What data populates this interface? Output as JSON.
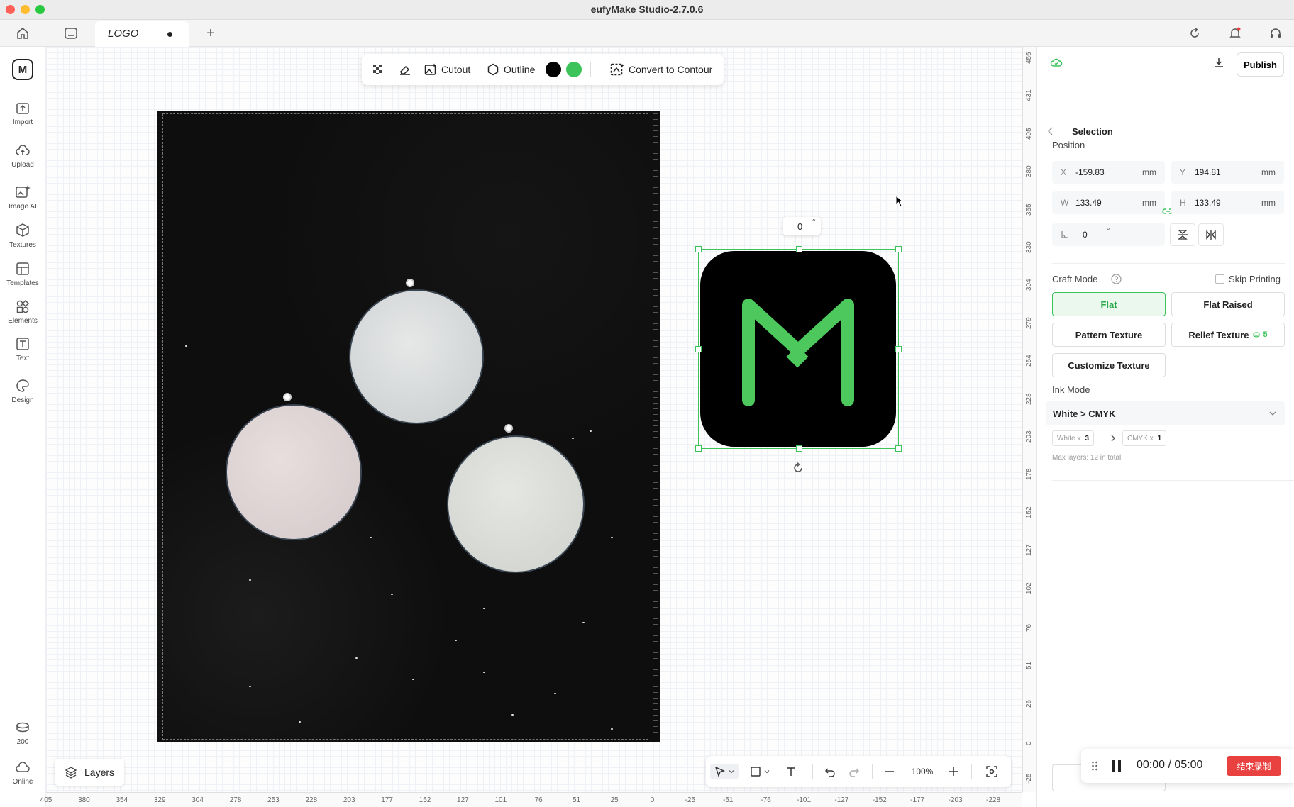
{
  "window": {
    "title": "eufyMake Studio-2.7.0.6"
  },
  "tabs": {
    "active_tab": "LOGO",
    "add": "+"
  },
  "sidebar": {
    "items": [
      {
        "label": "Import"
      },
      {
        "label": "Upload"
      },
      {
        "label": "Image AI"
      },
      {
        "label": "Textures"
      },
      {
        "label": "Templates"
      },
      {
        "label": "Elements"
      },
      {
        "label": "Text"
      },
      {
        "label": "Design"
      }
    ],
    "credits": "200",
    "online": "Online"
  },
  "float_toolbar": {
    "cutout": "Cutout",
    "outline": "Outline",
    "convert": "Convert to Contour",
    "colors": [
      "#000000",
      "#3cc35a"
    ]
  },
  "canvas": {
    "rotation_value": "0",
    "rotation_unit": "°",
    "layers_button": "Layers",
    "zoom": "100%"
  },
  "ruler_bottom": [
    "405",
    "380",
    "354",
    "329",
    "304",
    "278",
    "253",
    "228",
    "203",
    "177",
    "152",
    "127",
    "101",
    "76",
    "51",
    "25",
    "0",
    "-25",
    "-51",
    "-76",
    "-101",
    "-127",
    "-152",
    "-177",
    "-203",
    "-228"
  ],
  "ruler_right": [
    "456",
    "431",
    "405",
    "380",
    "355",
    "330",
    "304",
    "279",
    "254",
    "228",
    "203",
    "178",
    "152",
    "127",
    "102",
    "76",
    "51",
    "26",
    "0",
    "-25"
  ],
  "right_panel": {
    "publish": "Publish",
    "back_title": "Selection",
    "position_label": "Position",
    "x": {
      "key": "X",
      "value": "-159.83",
      "unit": "mm"
    },
    "y": {
      "key": "Y",
      "value": "194.81",
      "unit": "mm"
    },
    "w": {
      "key": "W",
      "value": "133.49",
      "unit": "mm"
    },
    "h": {
      "key": "H",
      "value": "133.49",
      "unit": "mm"
    },
    "angle": {
      "value": "0",
      "unit": "°"
    },
    "craft_mode_label": "Craft Mode",
    "skip_printing": "Skip Printing",
    "modes": {
      "flat": "Flat",
      "flat_raised": "Flat Raised",
      "pattern_texture": "Pattern Texture",
      "relief_texture": "Relief Texture",
      "relief_cost": "5",
      "customize_texture": "Customize Texture"
    },
    "ink_mode_label": "Ink Mode",
    "ink_mode_value": "White > CMYK",
    "white_chip": "White x",
    "white_count": "3",
    "cmyk_chip": "CMYK x",
    "cmyk_count": "1",
    "max_layers": "Max layers: 12 in total"
  },
  "recording": {
    "time": "00:00",
    "separator": "/",
    "total": "05:00",
    "stop_label": "结束录制"
  },
  "colors": {
    "accent": "#3cc35a",
    "record": "#e94040"
  }
}
